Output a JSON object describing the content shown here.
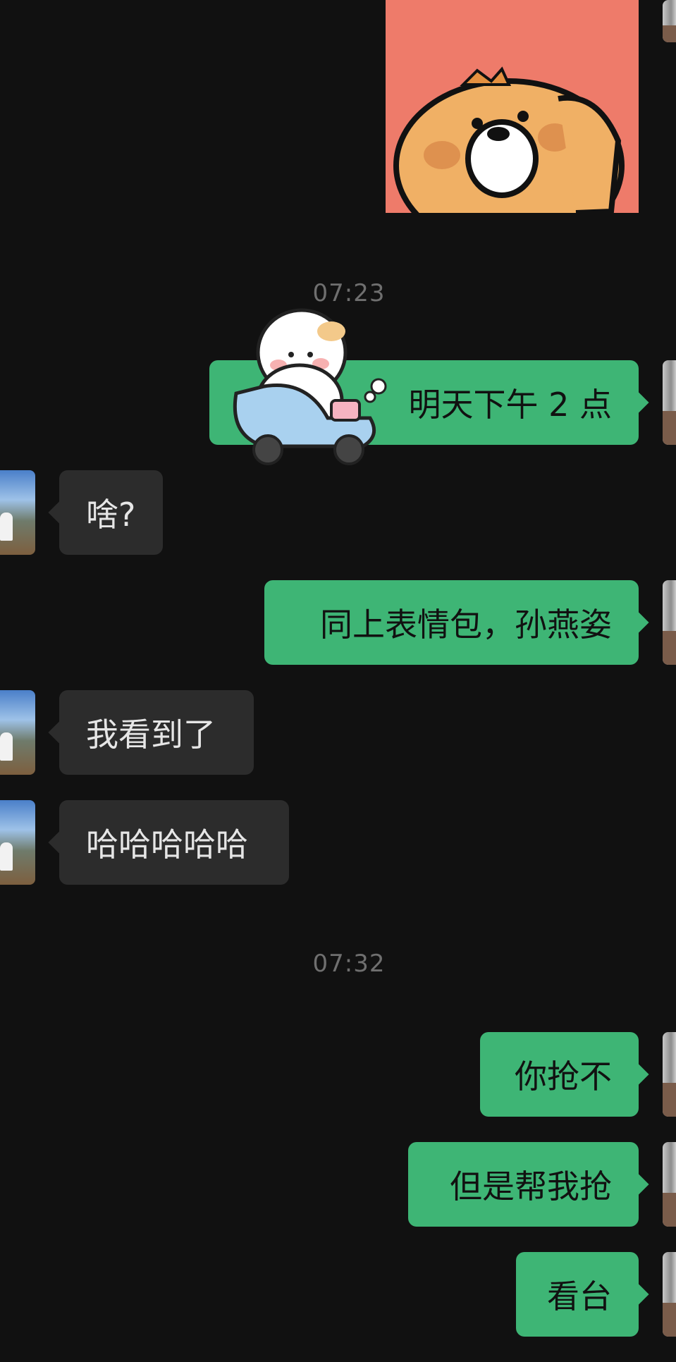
{
  "timestamps": [
    "07:23",
    "07:32"
  ],
  "messages": [
    {
      "side": "out",
      "text": "明天下午 2 点"
    },
    {
      "side": "in",
      "text": "啥?"
    },
    {
      "side": "out",
      "text": "同上表情包，孙燕姿"
    },
    {
      "side": "in",
      "text": "我看到了"
    },
    {
      "side": "in",
      "text": "哈哈哈哈哈"
    },
    {
      "side": "out",
      "text": "你抢不"
    },
    {
      "side": "out",
      "text": "但是帮我抢"
    },
    {
      "side": "out",
      "text": "看台"
    }
  ],
  "stickers": [
    {
      "name": "bear-sticker",
      "bg": "#ee7b6a"
    },
    {
      "name": "hamster-scooter-sticker",
      "scooter": "#a9d1ef"
    }
  ]
}
